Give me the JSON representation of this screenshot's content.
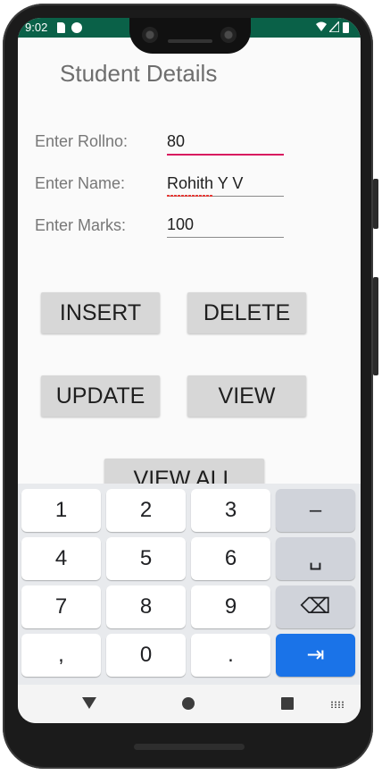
{
  "status_bar": {
    "time": "9:02",
    "icons": [
      "sd-card-icon",
      "google-play-icon",
      "wifi-icon",
      "signal-icon",
      "battery-icon"
    ],
    "background": "#0a6148"
  },
  "app": {
    "title": "Student Details",
    "fields": {
      "rollno": {
        "label": "Enter Rollno:",
        "value": "80"
      },
      "name": {
        "label": "Enter Name:",
        "value": "Rohith Y V"
      },
      "marks": {
        "label": "Enter Marks:",
        "value": "100"
      }
    },
    "buttons": {
      "insert": "INSERT",
      "delete": "DELETE",
      "update": "UPDATE",
      "view": "VIEW",
      "view_all": "VIEW ALL"
    }
  },
  "keyboard": {
    "rows": [
      [
        "1",
        "2",
        "3",
        "–"
      ],
      [
        "4",
        "5",
        "6",
        "␣"
      ],
      [
        "7",
        "8",
        "9",
        "⌫"
      ],
      [
        ",",
        "0",
        ".",
        "⇥"
      ]
    ],
    "accent": "#1a73e8"
  },
  "nav_bar": {
    "icons": [
      "back-icon",
      "home-icon",
      "recents-icon",
      "keyboard-switch-icon"
    ]
  }
}
